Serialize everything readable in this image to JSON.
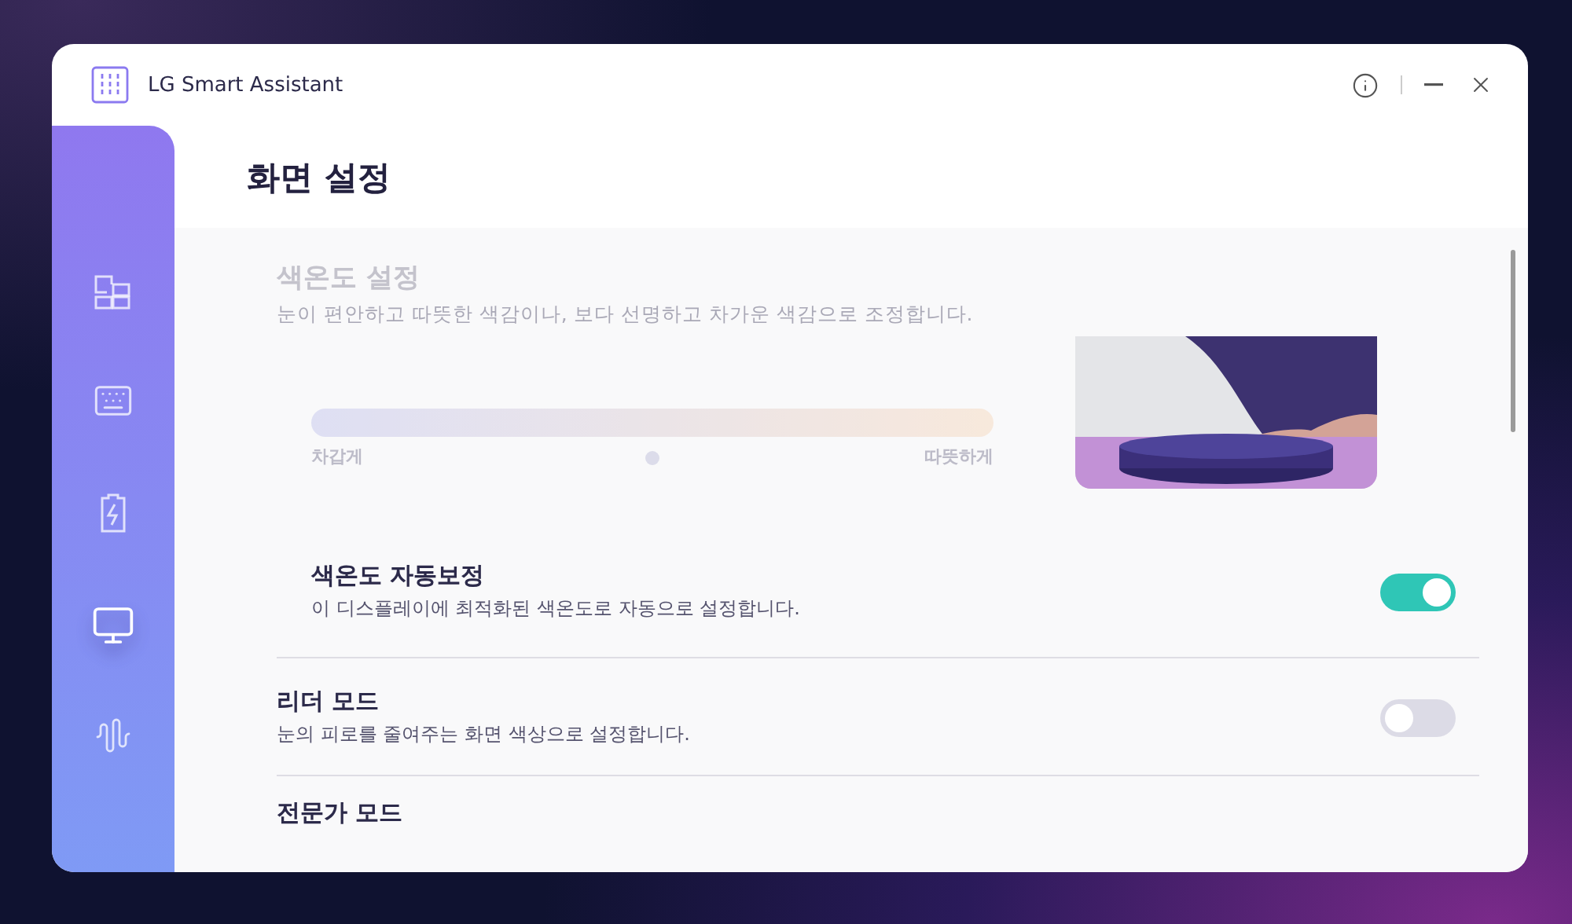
{
  "window": {
    "title": "LG Smart Assistant"
  },
  "sidebar": {
    "items": [
      {
        "kind": "dashboard",
        "selected": false
      },
      {
        "kind": "keyboard",
        "selected": false
      },
      {
        "kind": "battery",
        "selected": false
      },
      {
        "kind": "monitor",
        "selected": true
      },
      {
        "kind": "sound",
        "selected": false
      }
    ]
  },
  "page_title": "화면 설정",
  "color_temperature": {
    "title": "색온도 설정",
    "description": "눈이 편안하고 따뜻한 색감이나, 보다 선명하고 차가운 색감으로 조정합니다.",
    "disabled": true,
    "level": 0.5,
    "left_label": "차갑게",
    "right_label": "따뜻하게"
  },
  "settings": [
    {
      "kind": "sub",
      "title": "색온도 자동보정",
      "description": "이 디스플레이에 최적화된 색온도로 자동으로 설정합니다.",
      "on": true
    },
    {
      "kind": "main",
      "title": "리더 모드",
      "description": "눈의 피로를 줄여주는 화면 색상으로 설정합니다.",
      "on": false
    },
    {
      "kind": "heading",
      "title": "전문가 모드"
    }
  ]
}
